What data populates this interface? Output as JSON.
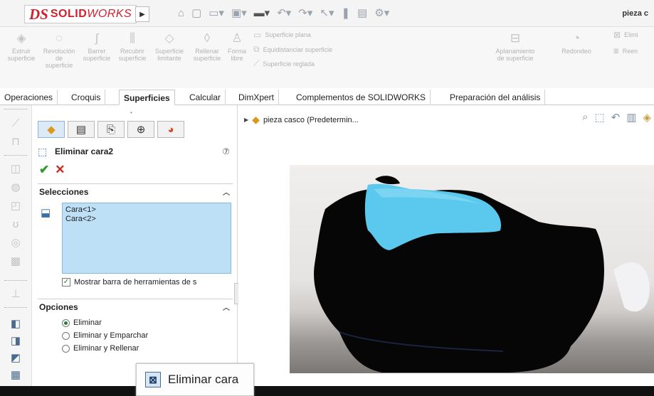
{
  "app": {
    "logo_prefix": "DS",
    "logo_name_bold": "SOLID",
    "logo_name_italic": "WORKS",
    "document_title": "pieza c"
  },
  "ribbon": {
    "buttons": [
      {
        "line1": "Extruir",
        "line2": "superficie",
        "line3": "",
        "icon": "extrude-surface-icon"
      },
      {
        "line1": "Revolución",
        "line2": "de",
        "line3": "superficie",
        "icon": "revolve-surface-icon"
      },
      {
        "line1": "Barrer",
        "line2": "superficie",
        "line3": "",
        "icon": "sweep-surface-icon"
      },
      {
        "line1": "Recubrir",
        "line2": "superficie",
        "line3": "",
        "icon": "loft-surface-icon"
      },
      {
        "line1": "Superficie",
        "line2": "limitante",
        "line3": "",
        "icon": "boundary-surface-icon"
      },
      {
        "line1": "Rellenar",
        "line2": "superficie",
        "line3": "",
        "icon": "fill-surface-icon"
      },
      {
        "line1": "Forma",
        "line2": "libre",
        "line3": "",
        "icon": "freeform-icon"
      }
    ],
    "rows": [
      {
        "label": "Superficie plana",
        "icon": "planar-surface-icon"
      },
      {
        "label": "Equidistanciar superficie",
        "icon": "offset-surface-icon"
      },
      {
        "label": "Superficie reglada",
        "icon": "ruled-surface-icon"
      }
    ],
    "right_buttons": [
      {
        "line1": "Aplanamiento",
        "line2": "de superficie",
        "icon": "flatten-surface-icon"
      },
      {
        "line1": "Redondeo",
        "line2": "",
        "icon": "fillet-icon"
      }
    ],
    "far_right": [
      {
        "label": "Elimi",
        "icon": "delete-face-icon"
      },
      {
        "label": "Reen",
        "icon": "replace-face-icon"
      }
    ]
  },
  "tabs": [
    {
      "label": "Operaciones",
      "active": false
    },
    {
      "label": "Croquis",
      "active": false
    },
    {
      "label": "Superficies",
      "active": true
    },
    {
      "label": "Calcular",
      "active": false
    },
    {
      "label": "DimXpert",
      "active": false
    },
    {
      "label": "Complementos de SOLIDWORKS",
      "active": false
    },
    {
      "label": "Preparación del análisis",
      "active": false
    }
  ],
  "property_manager": {
    "title": "Eliminar cara2",
    "help": "?",
    "selections_header": "Selecciones",
    "selections": [
      "Cara<1>",
      "Cara<2>"
    ],
    "show_toolbar_label": "Mostrar barra de herramientas de s",
    "show_toolbar_checked": true,
    "options_header": "Opciones",
    "options": [
      {
        "label": "Eliminar",
        "selected": true
      },
      {
        "label": "Eliminar y Emparchar",
        "selected": false
      },
      {
        "label": "Eliminar y Rellenar",
        "selected": false
      }
    ]
  },
  "feature_tree": {
    "root_label": "pieza casco  (Predetermin..."
  },
  "command_tooltip": {
    "label": "Eliminar cara"
  },
  "colors": {
    "accent": "#d21f2b",
    "selection_fill": "#bde0f6",
    "model_face_blue": "#5bc8ee",
    "model_body": "#050505"
  }
}
